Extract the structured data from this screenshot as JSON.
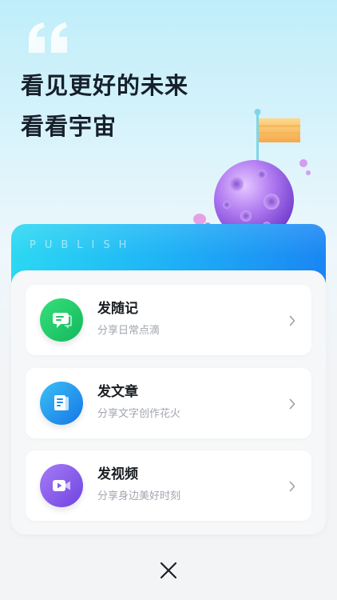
{
  "header": {
    "quote_icon": "quote-icon",
    "headline_line1": "看见更好的未来",
    "headline_line2": "看看宇宙",
    "illustration": "planet-with-flag"
  },
  "banner": {
    "label": "PUBLISH"
  },
  "menu": {
    "items": [
      {
        "title": "发随记",
        "subtitle": "分享日常点滴",
        "icon": "chat-bubble-icon",
        "color": "#1fc667"
      },
      {
        "title": "发文章",
        "subtitle": "分享文字创作花火",
        "icon": "document-icon",
        "color": "#1f8ff0"
      },
      {
        "title": "发视频",
        "subtitle": "分享身边美好时刻",
        "icon": "video-camera-icon",
        "color": "#8a5cf0"
      }
    ],
    "chevron_icon": "chevron-right-icon"
  },
  "footer": {
    "close_icon": "close-icon"
  },
  "colors": {
    "banner_start": "#2cd8f2",
    "banner_end": "#1a86f4",
    "title_text": "#17202b",
    "subtitle_text": "#a1a6ad"
  }
}
